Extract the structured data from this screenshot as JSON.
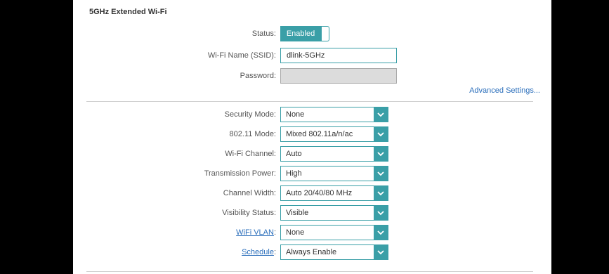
{
  "section": {
    "title": "5GHz Extended Wi-Fi"
  },
  "status": {
    "label": "Status:",
    "value": "Enabled"
  },
  "ssid": {
    "label": "Wi-Fi Name (SSID):",
    "value": "dlink-5GHz"
  },
  "password": {
    "label": "Password:",
    "value": ""
  },
  "advanced_link": "Advanced Settings...",
  "fields": [
    {
      "label": "Security Mode:",
      "value": "None",
      "link": false
    },
    {
      "label": "802.11 Mode:",
      "value": "Mixed 802.11a/n/ac",
      "link": false
    },
    {
      "label": "Wi-Fi Channel:",
      "value": "Auto",
      "link": false
    },
    {
      "label": "Transmission Power:",
      "value": "High",
      "link": false
    },
    {
      "label": "Channel Width:",
      "value": "Auto 20/40/80 MHz",
      "link": false
    },
    {
      "label": "Visibility Status:",
      "value": "Visible",
      "link": false
    },
    {
      "label": "WiFi VLAN",
      "value": "None",
      "link": true
    },
    {
      "label": "Schedule",
      "value": "Always Enable",
      "link": true
    }
  ],
  "colors": {
    "accent": "#3a9fa7",
    "link": "#2a6ebb"
  },
  "icons": {
    "dropdown": "chevron-down-icon"
  }
}
